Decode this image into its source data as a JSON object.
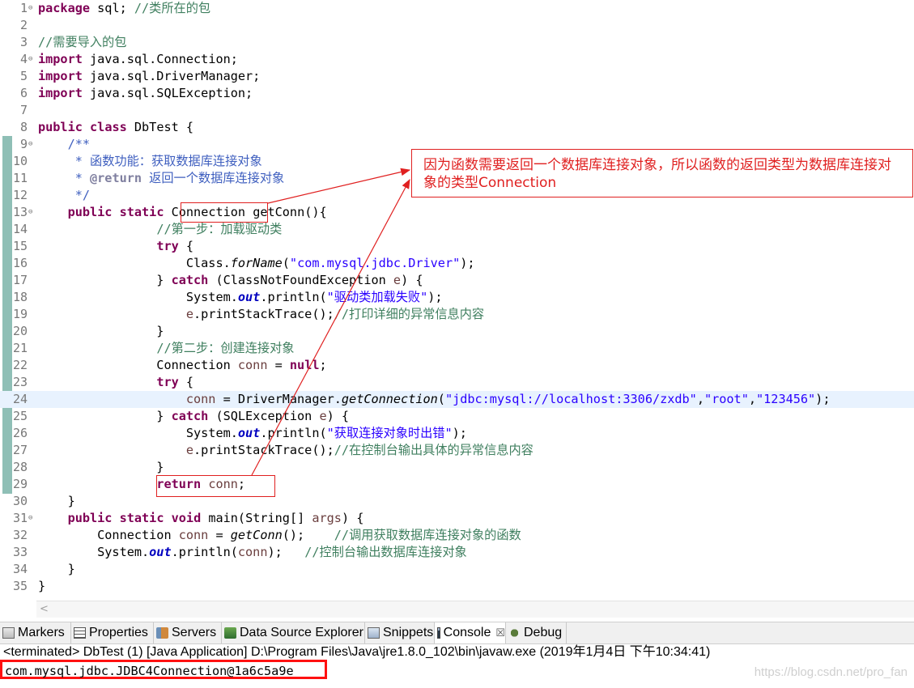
{
  "editor": {
    "lines": [
      {
        "n": "1",
        "fold": "⊖",
        "tokens": [
          {
            "t": "package",
            "c": "kw"
          },
          {
            "t": " sql; "
          },
          {
            "t": "//类所在的包",
            "c": "cm"
          }
        ]
      },
      {
        "n": "2",
        "tokens": []
      },
      {
        "n": "3",
        "tokens": [
          {
            "t": "//需要导入的包",
            "c": "cm"
          }
        ]
      },
      {
        "n": "4",
        "fold": "⊖",
        "tokens": [
          {
            "t": "import",
            "c": "kw"
          },
          {
            "t": " java.sql.Connection;"
          }
        ]
      },
      {
        "n": "5",
        "tokens": [
          {
            "t": "import",
            "c": "kw"
          },
          {
            "t": " java.sql.DriverManager;"
          }
        ]
      },
      {
        "n": "6",
        "tokens": [
          {
            "t": "import",
            "c": "kw"
          },
          {
            "t": " java.sql.SQLException;"
          }
        ]
      },
      {
        "n": "7",
        "tokens": []
      },
      {
        "n": "8",
        "tokens": [
          {
            "t": "public",
            "c": "kw"
          },
          {
            "t": " "
          },
          {
            "t": "class",
            "c": "kw"
          },
          {
            "t": " DbTest {"
          }
        ]
      },
      {
        "n": "9",
        "fold": "⊖",
        "tokens": [
          {
            "t": "    "
          },
          {
            "t": "/**",
            "c": "jd"
          }
        ]
      },
      {
        "n": "10",
        "tokens": [
          {
            "t": "     * 函数功能：获取数据库连接对象",
            "c": "jd"
          }
        ]
      },
      {
        "n": "11",
        "tokens": [
          {
            "t": "     * ",
            "c": "jd"
          },
          {
            "t": "@return",
            "c": "jt"
          },
          {
            "t": " 返回一个数据库连接对象",
            "c": "jd"
          }
        ]
      },
      {
        "n": "12",
        "tokens": [
          {
            "t": "     */",
            "c": "jd"
          }
        ]
      },
      {
        "n": "13",
        "fold": "⊖",
        "tokens": [
          {
            "t": "    "
          },
          {
            "t": "public",
            "c": "kw"
          },
          {
            "t": " "
          },
          {
            "t": "static",
            "c": "kw"
          },
          {
            "t": " Connection getConn(){"
          }
        ]
      },
      {
        "n": "14",
        "tokens": [
          {
            "t": "                "
          },
          {
            "t": "//第一步：加载驱动类",
            "c": "cm"
          }
        ]
      },
      {
        "n": "15",
        "tokens": [
          {
            "t": "                "
          },
          {
            "t": "try",
            "c": "kw"
          },
          {
            "t": " {"
          }
        ]
      },
      {
        "n": "16",
        "tokens": [
          {
            "t": "                    Class."
          },
          {
            "t": "forName",
            "c": "it"
          },
          {
            "t": "("
          },
          {
            "t": "\"com.mysql.jdbc.Driver\"",
            "c": "st"
          },
          {
            "t": ");"
          }
        ]
      },
      {
        "n": "17",
        "tokens": [
          {
            "t": "                } "
          },
          {
            "t": "catch",
            "c": "kw"
          },
          {
            "t": " (ClassNotFoundException "
          },
          {
            "t": "e",
            "c": "lv"
          },
          {
            "t": ") {"
          }
        ]
      },
      {
        "n": "18",
        "tokens": [
          {
            "t": "                    System."
          },
          {
            "t": "out",
            "c": "sf"
          },
          {
            "t": ".println("
          },
          {
            "t": "\"驱动类加载失败\"",
            "c": "st"
          },
          {
            "t": ");"
          }
        ]
      },
      {
        "n": "19",
        "tokens": [
          {
            "t": "                    "
          },
          {
            "t": "e",
            "c": "lv"
          },
          {
            "t": ".printStackTrace();"
          },
          {
            "t": "//打印详细的异常信息内容",
            "c": "cm"
          }
        ]
      },
      {
        "n": "20",
        "tokens": [
          {
            "t": "                }"
          }
        ]
      },
      {
        "n": "21",
        "tokens": [
          {
            "t": "                "
          },
          {
            "t": "//第二步：创建连接对象",
            "c": "cm"
          }
        ]
      },
      {
        "n": "22",
        "tokens": [
          {
            "t": "                Connection "
          },
          {
            "t": "conn",
            "c": "lv"
          },
          {
            "t": " = "
          },
          {
            "t": "null",
            "c": "kw"
          },
          {
            "t": ";"
          }
        ]
      },
      {
        "n": "23",
        "tokens": [
          {
            "t": "                "
          },
          {
            "t": "try",
            "c": "kw"
          },
          {
            "t": " {"
          }
        ]
      },
      {
        "n": "24",
        "current": true,
        "tokens": [
          {
            "t": "                    "
          },
          {
            "t": "conn",
            "c": "lv"
          },
          {
            "t": " = DriverManager."
          },
          {
            "t": "getConnection",
            "c": "it"
          },
          {
            "t": "("
          },
          {
            "t": "\"jdbc:mysql://localhost:3306/zxdb\"",
            "c": "st"
          },
          {
            "t": ","
          },
          {
            "t": "\"root\"",
            "c": "st"
          },
          {
            "t": ","
          },
          {
            "t": "\"123456\"",
            "c": "st"
          },
          {
            "t": ");"
          }
        ]
      },
      {
        "n": "25",
        "tokens": [
          {
            "t": "                } "
          },
          {
            "t": "catch",
            "c": "kw"
          },
          {
            "t": " (SQLException "
          },
          {
            "t": "e",
            "c": "lv"
          },
          {
            "t": ") {"
          }
        ]
      },
      {
        "n": "26",
        "tokens": [
          {
            "t": "                    System."
          },
          {
            "t": "out",
            "c": "sf"
          },
          {
            "t": ".println("
          },
          {
            "t": "\"获取连接对象时出错\"",
            "c": "st"
          },
          {
            "t": ");"
          }
        ]
      },
      {
        "n": "27",
        "tokens": [
          {
            "t": "                    "
          },
          {
            "t": "e",
            "c": "lv"
          },
          {
            "t": ".printStackTrace();"
          },
          {
            "t": "//在控制台输出具体的异常信息内容",
            "c": "cm"
          }
        ]
      },
      {
        "n": "28",
        "tokens": [
          {
            "t": "                }"
          }
        ]
      },
      {
        "n": "29",
        "tokens": [
          {
            "t": "                "
          },
          {
            "t": "return",
            "c": "kw"
          },
          {
            "t": " "
          },
          {
            "t": "conn",
            "c": "lv"
          },
          {
            "t": ";"
          }
        ]
      },
      {
        "n": "30",
        "tokens": [
          {
            "t": "    }"
          }
        ]
      },
      {
        "n": "31",
        "fold": "⊖",
        "tokens": [
          {
            "t": "    "
          },
          {
            "t": "public",
            "c": "kw"
          },
          {
            "t": " "
          },
          {
            "t": "static",
            "c": "kw"
          },
          {
            "t": " "
          },
          {
            "t": "void",
            "c": "kw"
          },
          {
            "t": " main(String[] "
          },
          {
            "t": "args",
            "c": "lv"
          },
          {
            "t": ") {"
          }
        ]
      },
      {
        "n": "32",
        "tokens": [
          {
            "t": "        Connection "
          },
          {
            "t": "conn",
            "c": "lv"
          },
          {
            "t": " = "
          },
          {
            "t": "getConn",
            "c": "it"
          },
          {
            "t": "();    "
          },
          {
            "t": "//调用获取数据库连接对象的函数",
            "c": "cm"
          }
        ]
      },
      {
        "n": "33",
        "tokens": [
          {
            "t": "        System."
          },
          {
            "t": "out",
            "c": "sf"
          },
          {
            "t": ".println("
          },
          {
            "t": "conn",
            "c": "lv"
          },
          {
            "t": ");   "
          },
          {
            "t": "//控制台输出数据库连接对象",
            "c": "cm"
          }
        ]
      },
      {
        "n": "34",
        "tokens": [
          {
            "t": "    }"
          }
        ]
      },
      {
        "n": "35",
        "tokens": [
          {
            "t": "}"
          }
        ]
      }
    ]
  },
  "annotation": {
    "note": "因为函数需要返回一个数据库连接对象，所以函数的返回类型为数据库连接对象的类型Connection",
    "accent": "#e02020"
  },
  "tabs": [
    {
      "label": "Markers",
      "icon": "markers-icon"
    },
    {
      "label": "Properties",
      "icon": "properties-icon"
    },
    {
      "label": "Servers",
      "icon": "servers-icon"
    },
    {
      "label": "Data Source Explorer",
      "icon": "data-source-explorer-icon"
    },
    {
      "label": "Snippets",
      "icon": "snippets-icon"
    },
    {
      "label": "Console",
      "icon": "console-icon",
      "active": true,
      "close": "☒"
    },
    {
      "label": "Debug",
      "icon": "debug-icon"
    }
  ],
  "console": {
    "terminated": "<terminated> DbTest (1) [Java Application] D:\\Program Files\\Java\\jre1.8.0_102\\bin\\javaw.exe (2019年1月4日 下午10:34:41)",
    "output": "com.mysql.jdbc.JDBC4Connection@1a6c5a9e",
    "watermark": "https://blog.csdn.net/pro_fan"
  },
  "scroll": {
    "left_arrow": "<"
  }
}
